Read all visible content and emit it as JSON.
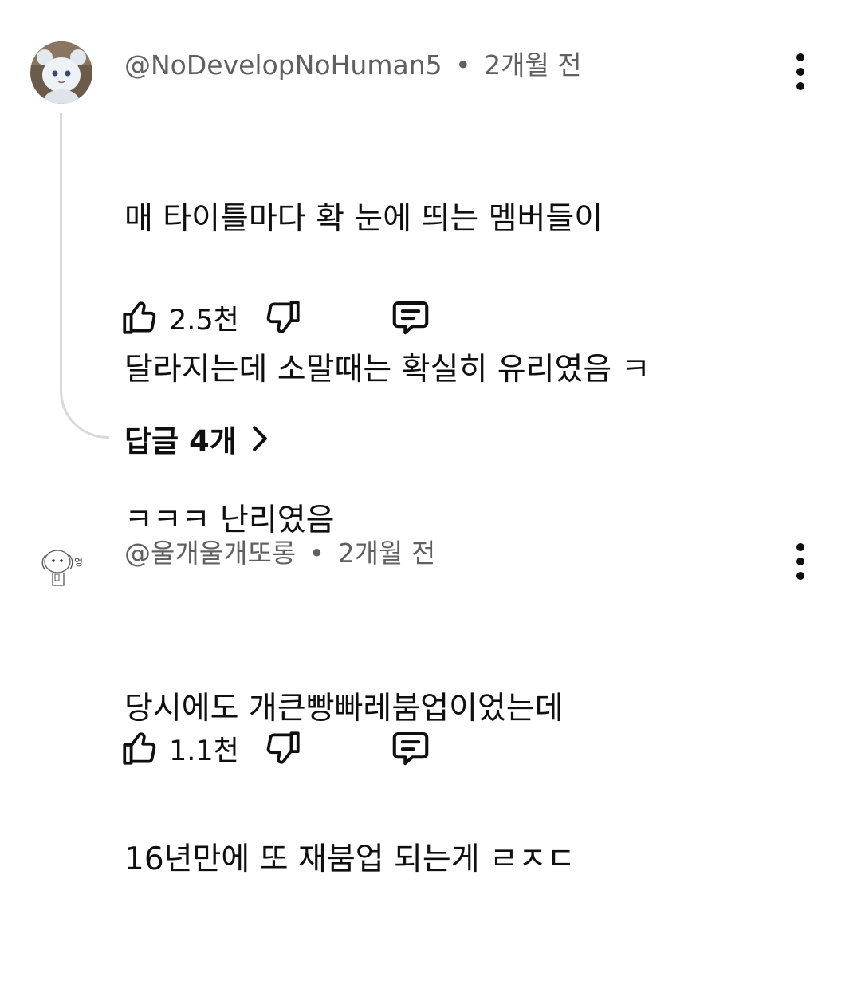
{
  "comments": [
    {
      "author": "@NoDevelopNoHuman5",
      "separator": "•",
      "time": "2개월 전",
      "lines": [
        "매 타이틀마다 확 눈에 띄는 멤버들이",
        "달라지는데 소말때는 확실히 유리였음 ㅋ",
        "ㅋㅋㅋ 난리였음"
      ],
      "likes": "2.5천",
      "replies_label": "답글 4개",
      "avatar_icon": "plush-toy-avatar",
      "icons": {
        "like": "thumb-up-icon",
        "dislike": "thumb-down-icon",
        "reply": "comment-icon",
        "more": "vertical-dots-icon",
        "chevron": "chevron-right-icon"
      }
    },
    {
      "author": "@울개울개또롱",
      "separator": "•",
      "time": "2개월 전",
      "lines": [
        "당시에도 개큰빵빠레붐업이었는데",
        "16년만에 또 재붐업 되는게 ㄹㅈㄷ"
      ],
      "likes": "1.1천",
      "avatar_icon": "sketch-dog-avatar",
      "avatar_text": "엉",
      "icons": {
        "like": "thumb-up-icon",
        "dislike": "thumb-down-icon",
        "reply": "comment-icon",
        "more": "vertical-dots-icon"
      }
    }
  ],
  "colors": {
    "text_primary": "#0f0f0f",
    "text_secondary": "#606060",
    "thread_line": "#d9d9d9",
    "background": "#ffffff"
  }
}
